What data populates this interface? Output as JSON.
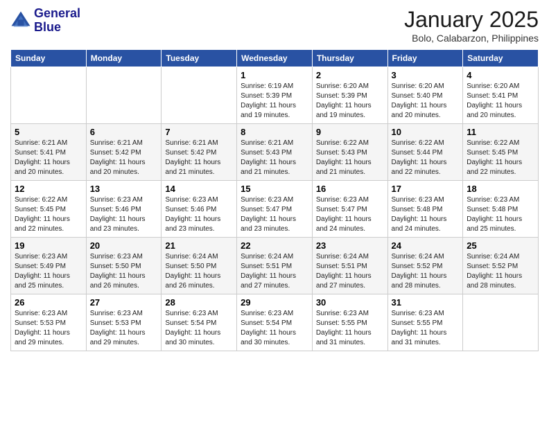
{
  "logo": {
    "line1": "General",
    "line2": "Blue"
  },
  "title": "January 2025",
  "location": "Bolo, Calabarzon, Philippines",
  "weekdays": [
    "Sunday",
    "Monday",
    "Tuesday",
    "Wednesday",
    "Thursday",
    "Friday",
    "Saturday"
  ],
  "weeks": [
    [
      {
        "day": "",
        "sunrise": "",
        "sunset": "",
        "daylight": ""
      },
      {
        "day": "",
        "sunrise": "",
        "sunset": "",
        "daylight": ""
      },
      {
        "day": "",
        "sunrise": "",
        "sunset": "",
        "daylight": ""
      },
      {
        "day": "1",
        "sunrise": "Sunrise: 6:19 AM",
        "sunset": "Sunset: 5:39 PM",
        "daylight": "Daylight: 11 hours and 19 minutes."
      },
      {
        "day": "2",
        "sunrise": "Sunrise: 6:20 AM",
        "sunset": "Sunset: 5:39 PM",
        "daylight": "Daylight: 11 hours and 19 minutes."
      },
      {
        "day": "3",
        "sunrise": "Sunrise: 6:20 AM",
        "sunset": "Sunset: 5:40 PM",
        "daylight": "Daylight: 11 hours and 20 minutes."
      },
      {
        "day": "4",
        "sunrise": "Sunrise: 6:20 AM",
        "sunset": "Sunset: 5:41 PM",
        "daylight": "Daylight: 11 hours and 20 minutes."
      }
    ],
    [
      {
        "day": "5",
        "sunrise": "Sunrise: 6:21 AM",
        "sunset": "Sunset: 5:41 PM",
        "daylight": "Daylight: 11 hours and 20 minutes."
      },
      {
        "day": "6",
        "sunrise": "Sunrise: 6:21 AM",
        "sunset": "Sunset: 5:42 PM",
        "daylight": "Daylight: 11 hours and 20 minutes."
      },
      {
        "day": "7",
        "sunrise": "Sunrise: 6:21 AM",
        "sunset": "Sunset: 5:42 PM",
        "daylight": "Daylight: 11 hours and 21 minutes."
      },
      {
        "day": "8",
        "sunrise": "Sunrise: 6:21 AM",
        "sunset": "Sunset: 5:43 PM",
        "daylight": "Daylight: 11 hours and 21 minutes."
      },
      {
        "day": "9",
        "sunrise": "Sunrise: 6:22 AM",
        "sunset": "Sunset: 5:43 PM",
        "daylight": "Daylight: 11 hours and 21 minutes."
      },
      {
        "day": "10",
        "sunrise": "Sunrise: 6:22 AM",
        "sunset": "Sunset: 5:44 PM",
        "daylight": "Daylight: 11 hours and 22 minutes."
      },
      {
        "day": "11",
        "sunrise": "Sunrise: 6:22 AM",
        "sunset": "Sunset: 5:45 PM",
        "daylight": "Daylight: 11 hours and 22 minutes."
      }
    ],
    [
      {
        "day": "12",
        "sunrise": "Sunrise: 6:22 AM",
        "sunset": "Sunset: 5:45 PM",
        "daylight": "Daylight: 11 hours and 22 minutes."
      },
      {
        "day": "13",
        "sunrise": "Sunrise: 6:23 AM",
        "sunset": "Sunset: 5:46 PM",
        "daylight": "Daylight: 11 hours and 23 minutes."
      },
      {
        "day": "14",
        "sunrise": "Sunrise: 6:23 AM",
        "sunset": "Sunset: 5:46 PM",
        "daylight": "Daylight: 11 hours and 23 minutes."
      },
      {
        "day": "15",
        "sunrise": "Sunrise: 6:23 AM",
        "sunset": "Sunset: 5:47 PM",
        "daylight": "Daylight: 11 hours and 23 minutes."
      },
      {
        "day": "16",
        "sunrise": "Sunrise: 6:23 AM",
        "sunset": "Sunset: 5:47 PM",
        "daylight": "Daylight: 11 hours and 24 minutes."
      },
      {
        "day": "17",
        "sunrise": "Sunrise: 6:23 AM",
        "sunset": "Sunset: 5:48 PM",
        "daylight": "Daylight: 11 hours and 24 minutes."
      },
      {
        "day": "18",
        "sunrise": "Sunrise: 6:23 AM",
        "sunset": "Sunset: 5:48 PM",
        "daylight": "Daylight: 11 hours and 25 minutes."
      }
    ],
    [
      {
        "day": "19",
        "sunrise": "Sunrise: 6:23 AM",
        "sunset": "Sunset: 5:49 PM",
        "daylight": "Daylight: 11 hours and 25 minutes."
      },
      {
        "day": "20",
        "sunrise": "Sunrise: 6:23 AM",
        "sunset": "Sunset: 5:50 PM",
        "daylight": "Daylight: 11 hours and 26 minutes."
      },
      {
        "day": "21",
        "sunrise": "Sunrise: 6:24 AM",
        "sunset": "Sunset: 5:50 PM",
        "daylight": "Daylight: 11 hours and 26 minutes."
      },
      {
        "day": "22",
        "sunrise": "Sunrise: 6:24 AM",
        "sunset": "Sunset: 5:51 PM",
        "daylight": "Daylight: 11 hours and 27 minutes."
      },
      {
        "day": "23",
        "sunrise": "Sunrise: 6:24 AM",
        "sunset": "Sunset: 5:51 PM",
        "daylight": "Daylight: 11 hours and 27 minutes."
      },
      {
        "day": "24",
        "sunrise": "Sunrise: 6:24 AM",
        "sunset": "Sunset: 5:52 PM",
        "daylight": "Daylight: 11 hours and 28 minutes."
      },
      {
        "day": "25",
        "sunrise": "Sunrise: 6:24 AM",
        "sunset": "Sunset: 5:52 PM",
        "daylight": "Daylight: 11 hours and 28 minutes."
      }
    ],
    [
      {
        "day": "26",
        "sunrise": "Sunrise: 6:23 AM",
        "sunset": "Sunset: 5:53 PM",
        "daylight": "Daylight: 11 hours and 29 minutes."
      },
      {
        "day": "27",
        "sunrise": "Sunrise: 6:23 AM",
        "sunset": "Sunset: 5:53 PM",
        "daylight": "Daylight: 11 hours and 29 minutes."
      },
      {
        "day": "28",
        "sunrise": "Sunrise: 6:23 AM",
        "sunset": "Sunset: 5:54 PM",
        "daylight": "Daylight: 11 hours and 30 minutes."
      },
      {
        "day": "29",
        "sunrise": "Sunrise: 6:23 AM",
        "sunset": "Sunset: 5:54 PM",
        "daylight": "Daylight: 11 hours and 30 minutes."
      },
      {
        "day": "30",
        "sunrise": "Sunrise: 6:23 AM",
        "sunset": "Sunset: 5:55 PM",
        "daylight": "Daylight: 11 hours and 31 minutes."
      },
      {
        "day": "31",
        "sunrise": "Sunrise: 6:23 AM",
        "sunset": "Sunset: 5:55 PM",
        "daylight": "Daylight: 11 hours and 31 minutes."
      },
      {
        "day": "",
        "sunrise": "",
        "sunset": "",
        "daylight": ""
      }
    ]
  ]
}
